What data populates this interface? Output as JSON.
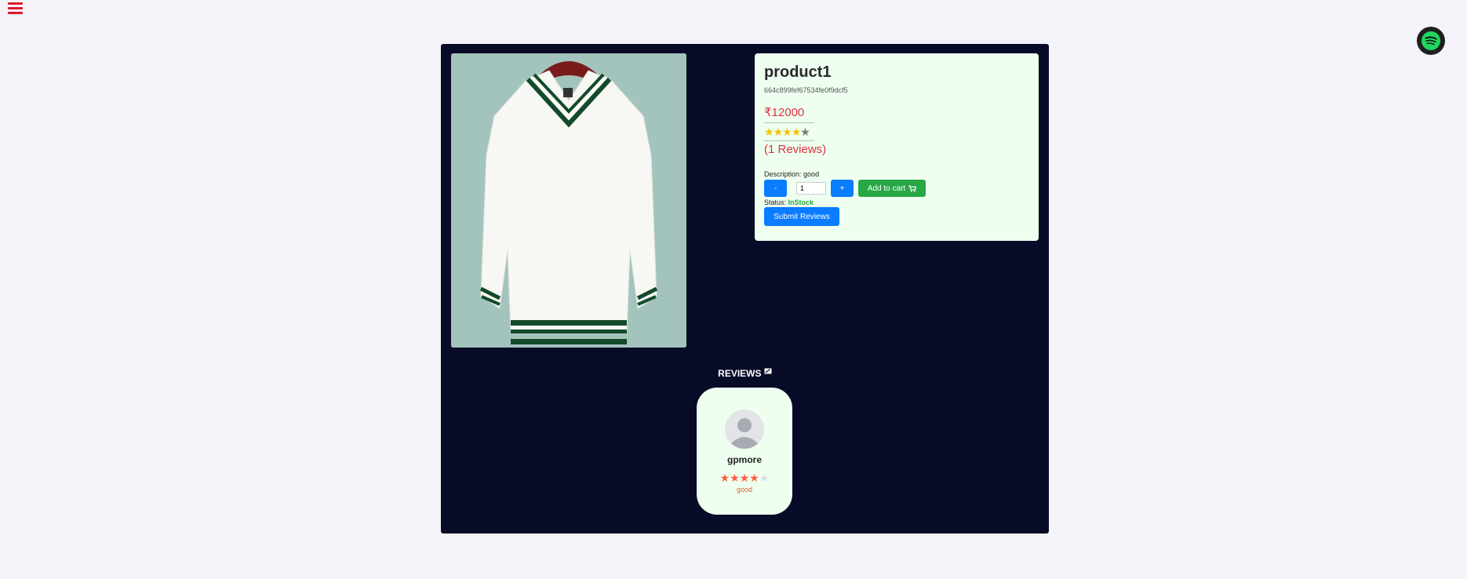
{
  "nav": {
    "menu_icon": "hamburger-menu-icon",
    "spotify_icon": "spotify-icon"
  },
  "colors": {
    "background": "#f3f3f9",
    "card": "#070b27",
    "panel": "#eefff0",
    "accent_red": "#e0303a",
    "button_blue": "#0a7cff",
    "button_green": "#28a745",
    "star_gold": "#f2c200",
    "review_star": "#ff5b3a"
  },
  "product": {
    "image_alt": "white sweater",
    "title": "product1",
    "id": "664c899fef67534fe0f9dcf5",
    "price": "₹12000",
    "rating": 4,
    "rating_max": 5,
    "reviews_count": "(1 Reviews)",
    "description_label": "Description:",
    "description": "good",
    "decrement_label": "-",
    "quantity": "1",
    "increment_label": "+",
    "add_to_cart_label": "Add to cart",
    "cart_icon": "shopping-cart-icon",
    "status_label": "Status:",
    "status": "InStock",
    "submit_reviews_label": "Submit Reviews"
  },
  "reviews": {
    "heading": "REVIEWS",
    "heading_icon": "review-icon",
    "items": [
      {
        "avatar_icon": "user-avatar-icon",
        "name": "gpmore",
        "rating": 4,
        "rating_max": 5,
        "comment": "good"
      }
    ]
  }
}
